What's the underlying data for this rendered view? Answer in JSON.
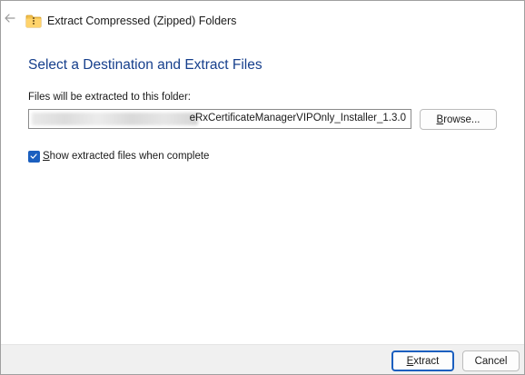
{
  "window": {
    "title": "Extract Compressed (Zipped) Folders"
  },
  "icons": {
    "back": "back-arrow-icon",
    "folder": "zipped-folder-icon",
    "check": "checkmark-icon"
  },
  "page": {
    "heading": "Select a Destination and Extract Files",
    "destination_label": "Files will be extracted to this folder:",
    "destination_value_visible": "eRxCertificateManagerVIPOnly_Installer_1.3.0",
    "browse_label_u": "B",
    "browse_label_rest": "rowse...",
    "show_files_u": "S",
    "show_files_rest": "how extracted files when complete",
    "show_files_checked": true
  },
  "footer": {
    "extract_u": "E",
    "extract_rest": "xtract",
    "cancel_label": "Cancel"
  },
  "colors": {
    "heading": "#163f8c",
    "accent": "#1b5fbf",
    "footer_bg": "#f0f0f0"
  }
}
